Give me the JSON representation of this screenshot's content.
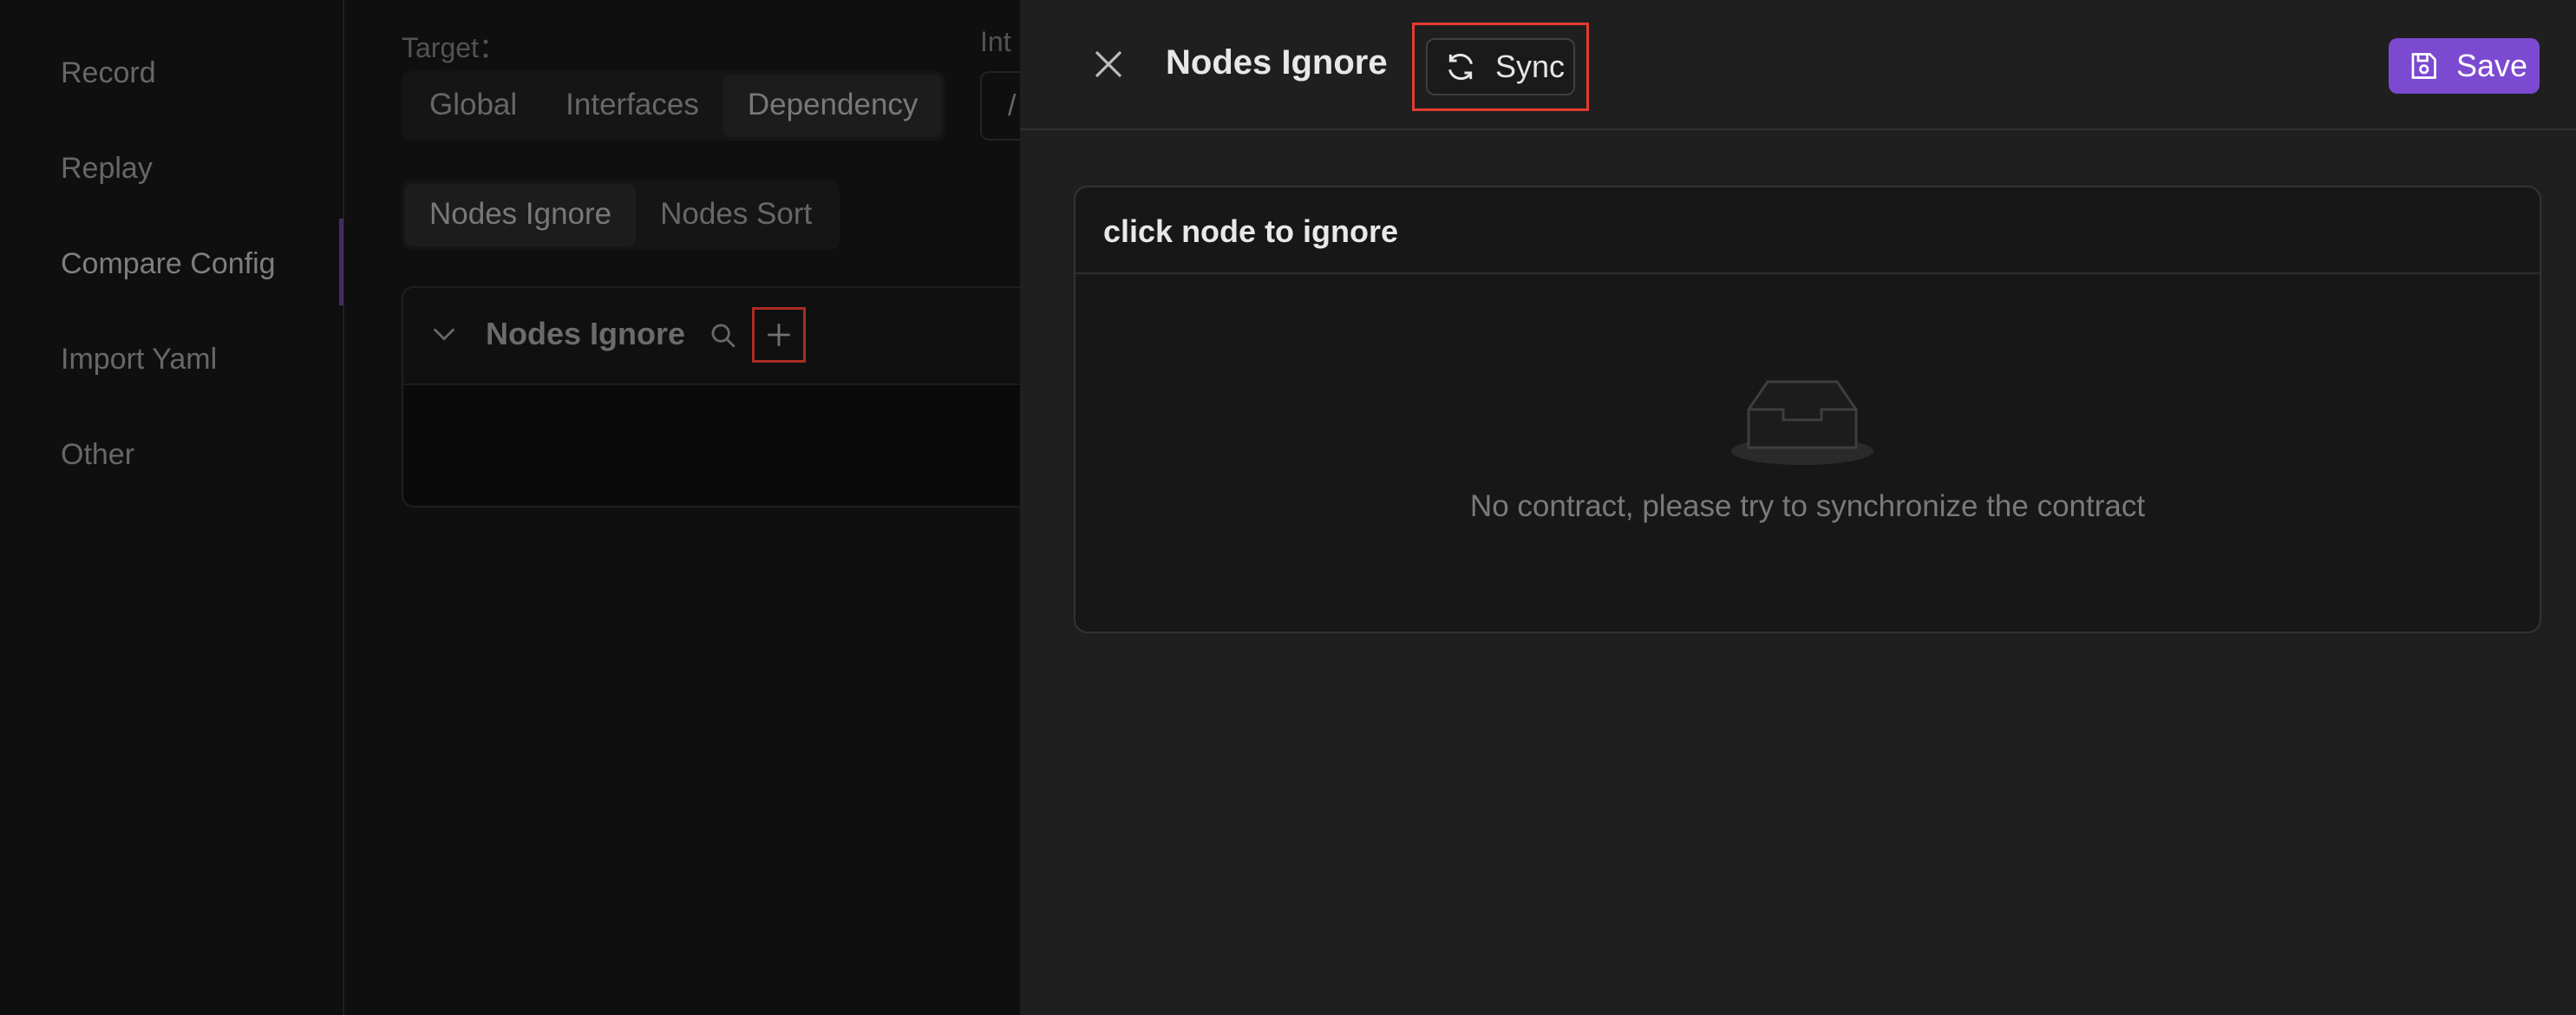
{
  "sidebar": {
    "items": [
      {
        "label": "Record"
      },
      {
        "label": "Replay"
      },
      {
        "label": "Compare Config"
      },
      {
        "label": "Import Yaml"
      },
      {
        "label": "Other"
      }
    ],
    "active_item": "Compare Config"
  },
  "config": {
    "target_label": "Target：",
    "interface_label": "Int",
    "target_options": [
      "Global",
      "Interfaces",
      "Dependency"
    ],
    "target_selected": "Dependency",
    "interface_value": "/",
    "mode_tabs": [
      "Nodes Ignore",
      "Nodes Sort"
    ],
    "mode_selected": "Nodes Ignore",
    "panel_title": "Nodes Ignore"
  },
  "drawer": {
    "title": "Nodes Ignore",
    "sync_label": "Sync",
    "save_label": "Save",
    "card_title": "click node to ignore",
    "empty_text": "No contract, please try to synchronize the contract"
  },
  "colors": {
    "accent": "#7b4ad0",
    "highlight_box": "#e53a2f",
    "drawer_bg": "#1f1f1f",
    "page_bg": "#141414"
  },
  "icons": {
    "close": "close-icon",
    "sync": "sync-icon",
    "save": "save-icon",
    "search": "search-icon",
    "add": "plus-icon",
    "collapse": "chevron-down-icon",
    "empty": "empty-inbox-icon"
  }
}
